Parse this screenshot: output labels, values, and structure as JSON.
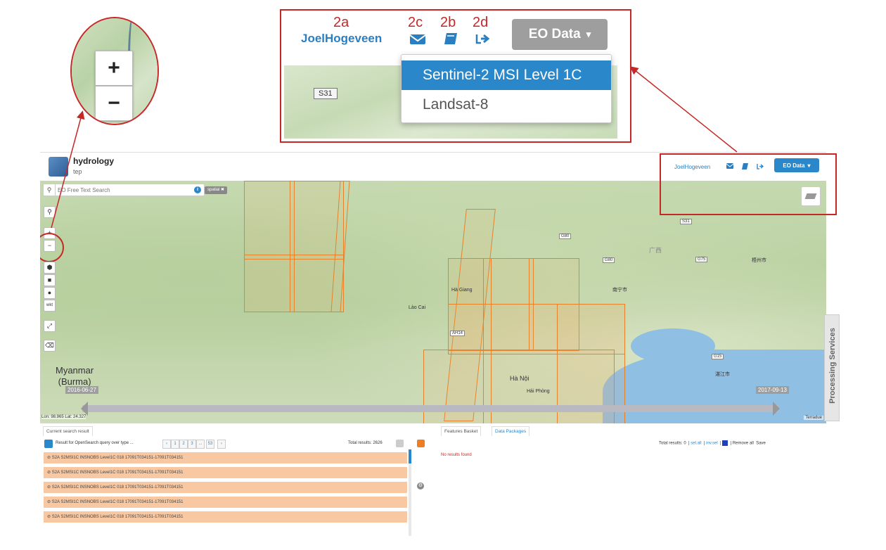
{
  "callouts": {
    "numbers": [
      "2a",
      "2c",
      "2b",
      "2d"
    ],
    "zoom_in": "+",
    "zoom_out": "−",
    "user": "JoelHogeveen",
    "eo_button": "EO Data",
    "eo_caret": "▾",
    "menu_items": [
      "Sentinel-2 MSI Level 1C",
      "Landsat-8"
    ],
    "road_sign": "S31"
  },
  "header": {
    "title": "hydrology",
    "subtitle": "tep",
    "user": "JoelHogeveen",
    "eo_button": "EO Data",
    "eo_caret": "▾"
  },
  "map": {
    "search_placeholder": "EO Free Text Search",
    "spatial_tag": "spatial ✖",
    "country_label_1": "Myanmar",
    "country_label_2": "(Burma)",
    "slider_start": "2016-06-27",
    "slider_end": "2017-09-13",
    "lonlat": "Lon: 98.965 Lat: 24.327",
    "attribution": "Terradue",
    "places": [
      "Hà Giang",
      "Lào Cai",
      "Hà Nội",
      "Hải Phòng",
      "南宁市",
      "梧州市",
      "湛江市",
      "广西"
    ],
    "signs": [
      "S31",
      "G80",
      "G75",
      "G80",
      "G15",
      "AH14"
    ],
    "processing_tab": "Processing Services"
  },
  "left_panel": {
    "tab": "Current search result",
    "query_text": "Result for OpenSearch query over type ...",
    "pages": [
      "‹",
      "1",
      "2",
      "3",
      "...",
      "53",
      "›"
    ],
    "total": "Total results: 2626",
    "rows": [
      "⊘ S2A S2MSI1C INSNOBS Level1C 018 17091T034151-17091T034151",
      "⊘ S2A S2MSI1C INSNOBS Level1C 018 17091T034151-17091T034151",
      "⊘ S2A S2MSI1C INSNOBS Level1C 018 17091T034151-17091T034151",
      "⊘ S2A S2MSI1C INSNOBS Level1C 018 17091T034151-17091T034151",
      "⊘ S2A S2MSI1C INSNOBS Level1C 018 17091T034151-17091T034151"
    ]
  },
  "right_panel": {
    "tabs": [
      "Features Basket",
      "Data Packages"
    ],
    "total": "Total results: 0",
    "sel_all": "sel.all",
    "inv_sel": "inv.sel",
    "remove_all": "Remove all",
    "save": "Save",
    "no_results": "No results found"
  },
  "colors": {
    "annotation_red": "#c62828",
    "brand_blue": "#2a87c9",
    "footprint_orange": "#e5822a",
    "result_row": "#f7c8a2"
  }
}
